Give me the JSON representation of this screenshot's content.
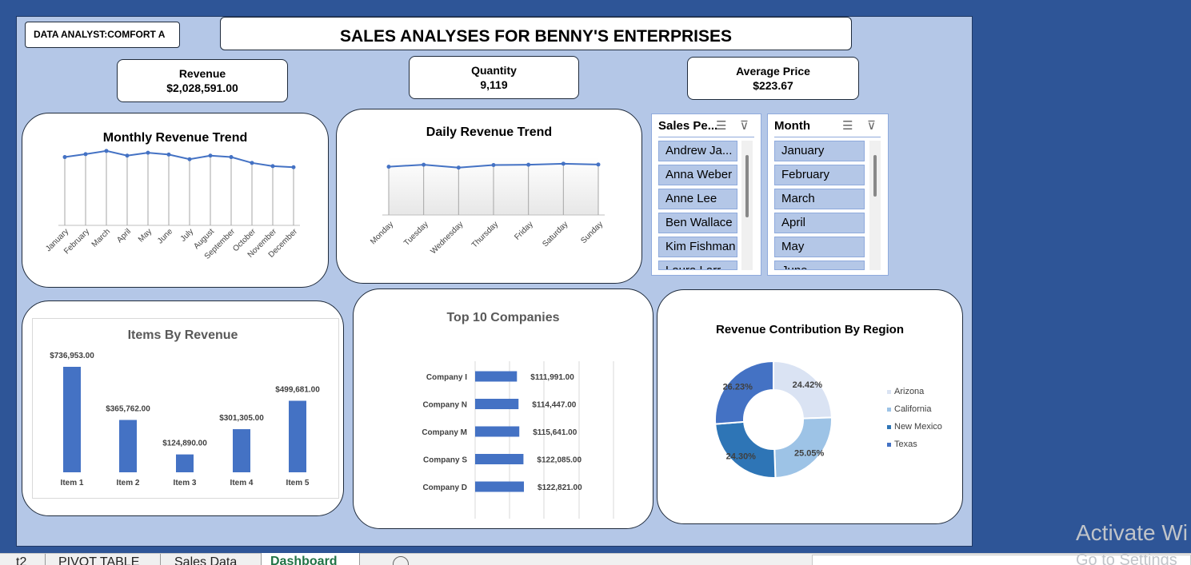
{
  "header": {
    "analyst": "DATA ANALYST:COMFORT A",
    "title": "SALES ANALYSES FOR BENNY'S ENTERPRISES"
  },
  "kpis": [
    {
      "label": "Revenue",
      "value": "$2,028,591.00"
    },
    {
      "label": "Quantity",
      "value": "9,119"
    },
    {
      "label": "Average Price",
      "value": "$223.67"
    }
  ],
  "monthly": {
    "title": "Monthly Revenue Trend",
    "chart_data": {
      "type": "line",
      "categories": [
        "January",
        "February",
        "March",
        "April",
        "May",
        "June",
        "July",
        "August",
        "September",
        "October",
        "November",
        "December"
      ],
      "values": [
        188,
        196,
        205,
        192,
        200,
        195,
        182,
        192,
        188,
        172,
        163,
        160
      ],
      "ylim": [
        0,
        220
      ]
    }
  },
  "daily": {
    "title": "Daily Revenue Trend",
    "chart_data": {
      "type": "line",
      "categories": [
        "Monday",
        "Tuesday",
        "Wednesday",
        "Thursday",
        "Friday",
        "Saturday",
        "Sunday"
      ],
      "values": [
        285,
        297,
        280,
        295,
        297,
        303,
        298
      ],
      "ylim": [
        0,
        340
      ]
    }
  },
  "items": {
    "title": "Items By Revenue",
    "chart_data": {
      "type": "bar",
      "categories": [
        "Item 1",
        "Item 2",
        "Item 3",
        "Item 4",
        "Item 5"
      ],
      "values": [
        736953,
        365762,
        124890,
        301305,
        499681
      ],
      "labels": [
        "$736,953.00",
        "$365,762.00",
        "$124,890.00",
        "$301,305.00",
        "$499,681.00"
      ]
    }
  },
  "companies": {
    "title": "Top 10 Companies",
    "chart_data": {
      "type": "bar",
      "orientation": "horizontal",
      "categories": [
        "Company I",
        "Company N",
        "Company M",
        "Company S",
        "Company D"
      ],
      "values": [
        111991,
        114447,
        115641,
        122085,
        122821
      ],
      "labels": [
        "$111,991.00",
        "$114,447.00",
        "$115,641.00",
        "$122,085.00",
        "$122,821.00"
      ]
    }
  },
  "region": {
    "title": "Revenue Contribution By Region",
    "chart_data": {
      "type": "pie",
      "donut": true,
      "categories": [
        "Arizona",
        "California",
        "New Mexico",
        "Texas"
      ],
      "values": [
        24.42,
        25.05,
        24.3,
        26.23
      ],
      "labels": [
        "24.42%",
        "25.05%",
        "24.30%",
        "26.23%"
      ],
      "colors": [
        "#dae3f3",
        "#9dc3e6",
        "#2e75b6",
        "#4472c4"
      ],
      "legend": "right"
    }
  },
  "slicers": {
    "salesperson": {
      "title": "Sales Pe...",
      "items": [
        "Andrew Ja...",
        "Anna Weber",
        "Anne Lee",
        "Ben Wallace",
        "Kim Fishman",
        "Laura Larr..."
      ]
    },
    "month": {
      "title": "Month",
      "items": [
        "January",
        "February",
        "March",
        "April",
        "May",
        "June"
      ]
    }
  },
  "sheet_tabs": [
    "t2",
    "PIVOT TABLE",
    "Sales Data",
    "Dashboard"
  ],
  "watermark": {
    "line1": "Activate Wi",
    "line2": "Go to Settings"
  },
  "colors": {
    "accent": "#4472c4",
    "dashboard_bg": "#b4c7e7",
    "outer_bg": "#2e5597"
  }
}
